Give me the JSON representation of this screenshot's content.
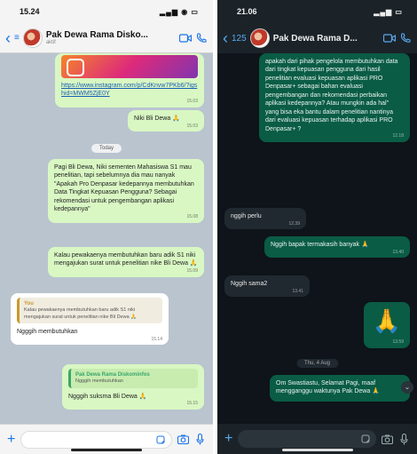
{
  "left": {
    "status_time": "15.24",
    "contact_name": "Pak Dewa Rama Disko...",
    "contact_sub": "aktif",
    "messages": [
      {
        "text": "",
        "link": "https://www.instagram.com/p/CdKnvw7PKb6/?igshid=MWM5ZjE0Y",
        "time": "15.03"
      },
      {
        "text": "Niki Bli Dewa 🙏",
        "time": "15.03"
      },
      {
        "text": "Pagi Bli Dewa, Niki sementen Mahasiswa S1 mau penelitian, tapi sebelumnya dia mau nanyak \"Apakah Pro Denpasar kedepannya membutuhkan Data Tingkat Kepuasan Pengguna? Sebagai rekomendasi untuk pengembangan aplikasi kedepannya\"",
        "time": "15.08"
      },
      {
        "text": "Kalau pewakaenya membutuhkan baru adik S1 niki mengajukan surat untuk penelitian nike Bli Dewa 🙏",
        "time": "15.09"
      },
      {
        "quote_name": "You",
        "quote_text": "Kalau pewakaenya membutuhkan baru adik S1 niki mengajukan surat untuk penelitian nike Bli Dewa 🙏",
        "text": "Ngggih membutuhkan",
        "time": "15.14"
      },
      {
        "quote_name": "Pak Dewa Rama Diskominfos",
        "quote_text": "Ngggih membutuhkan",
        "text": "Ngggih suksma Bli Dewa 🙏",
        "time": "15.15"
      }
    ],
    "day_label": "Today"
  },
  "right": {
    "status_time": "21.06",
    "back_count": "125",
    "contact_name": "Pak Dewa Rama D...",
    "messages": [
      {
        "text": "apakah dari pihak pengelola membutuhkan data  dari tingkat kepuasan pengguna dari hasil penelitian evaluasi kepuasan aplikasi PRO Denpasar+ sebagai bahan evaluasi pengembangan dan rekomendasi perbaikan aplikasi kedepannya? Atau mungkin ada hal\" yang bisa eka bantu dalam penelitian nantinya dari evaluasi kepuasan terhadap aplikasi PRO Denpasar+ ?",
        "time": "12.18"
      },
      {
        "text": "nggih perlu",
        "time": "12.39"
      },
      {
        "text": "Nggih bapak termakasih banyak 🙏",
        "time": "13.40"
      },
      {
        "text": "Nggih sama2",
        "time": "13.41"
      },
      {
        "text": "🙏",
        "time": "13.59"
      },
      {
        "text": "Om Swastiastu, Selamat Pagi, maaf mengganggu waktunya Pak Dewa 🙏",
        "time": ""
      }
    ],
    "day_label": "Thu, 4 Aug"
  },
  "icons": {
    "video": "video-call-icon",
    "phone": "phone-call-icon",
    "sticker": "sticker-icon",
    "camera": "camera-icon",
    "mic": "mic-icon"
  }
}
